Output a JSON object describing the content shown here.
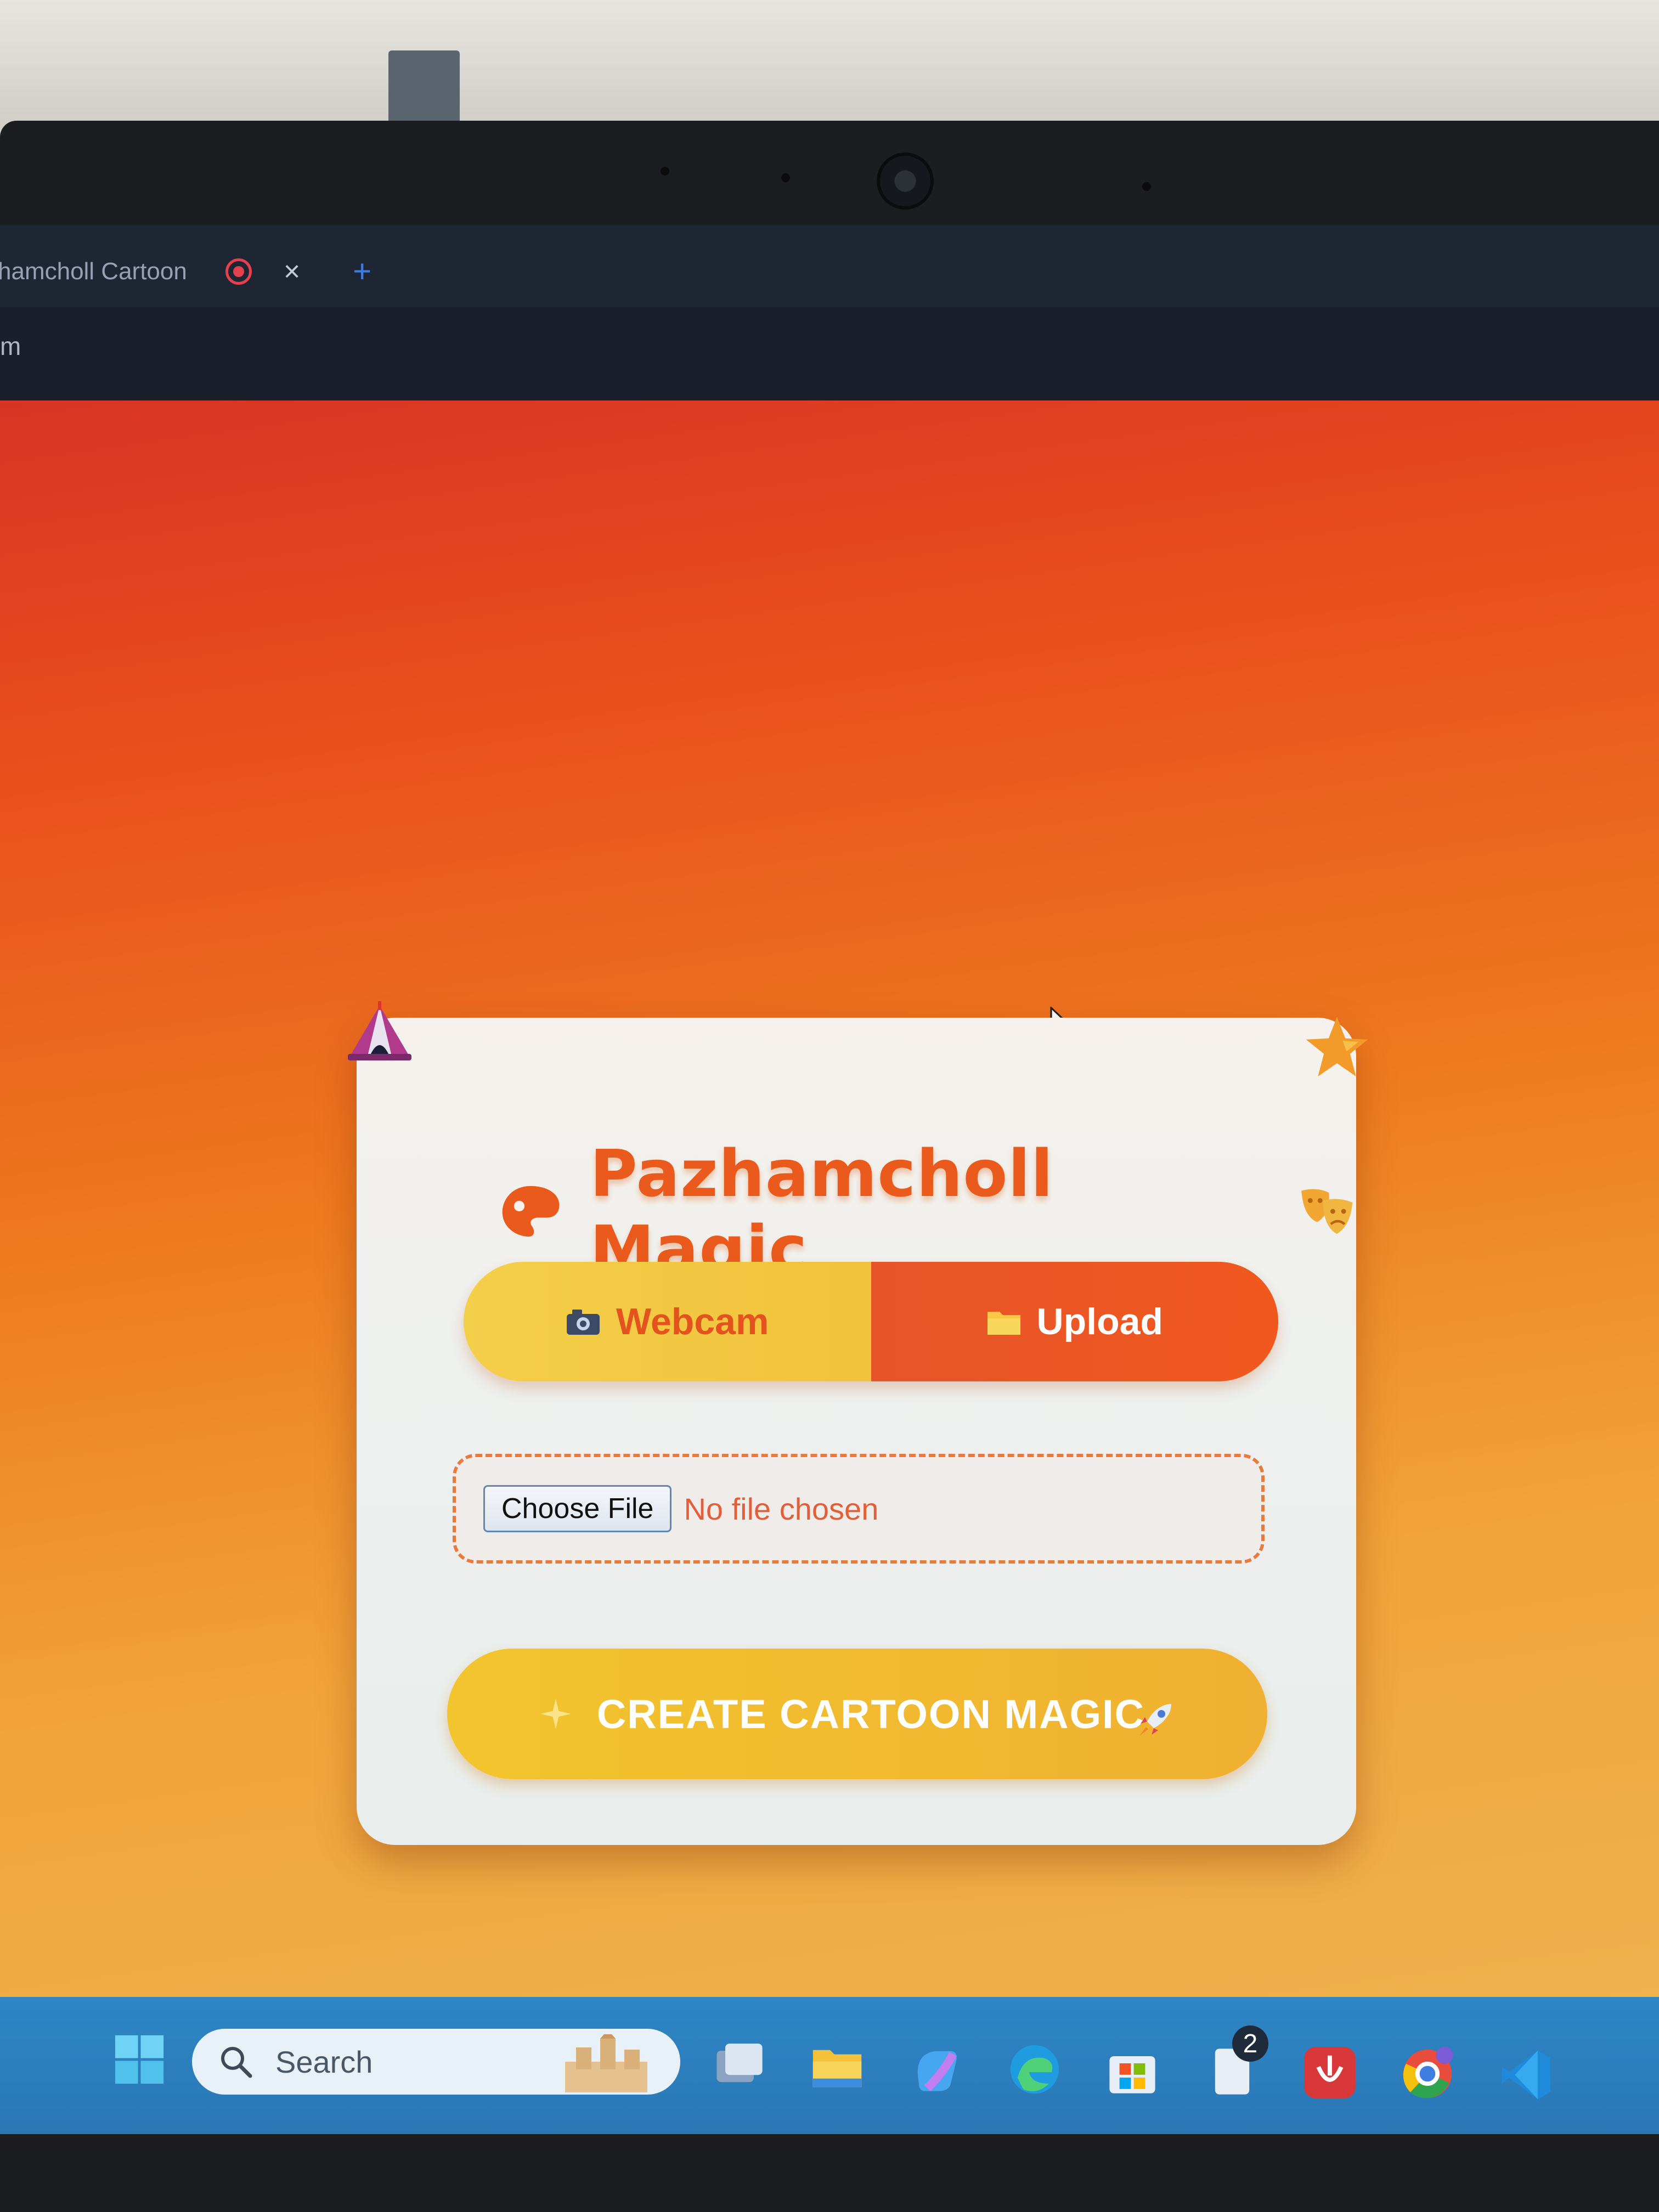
{
  "browser": {
    "tab_title": "hamcholl Cartoon",
    "url_fragment": "m"
  },
  "app": {
    "title": "Pazhamcholl Magic",
    "tabs": [
      {
        "label": "Webcam",
        "icon": "camera-icon"
      },
      {
        "label": "Upload",
        "icon": "folder-icon"
      }
    ],
    "file_input": {
      "button_label": "Choose File",
      "status": "No file chosen"
    },
    "create_button_label": "CREATE CARTOON MAGIC"
  },
  "taskbar": {
    "search_placeholder": "Search",
    "notification_count": "2"
  },
  "colors": {
    "accent": "#ea5a1c",
    "yellow": "#f2c52e",
    "taskbar": "#2e86c4"
  }
}
